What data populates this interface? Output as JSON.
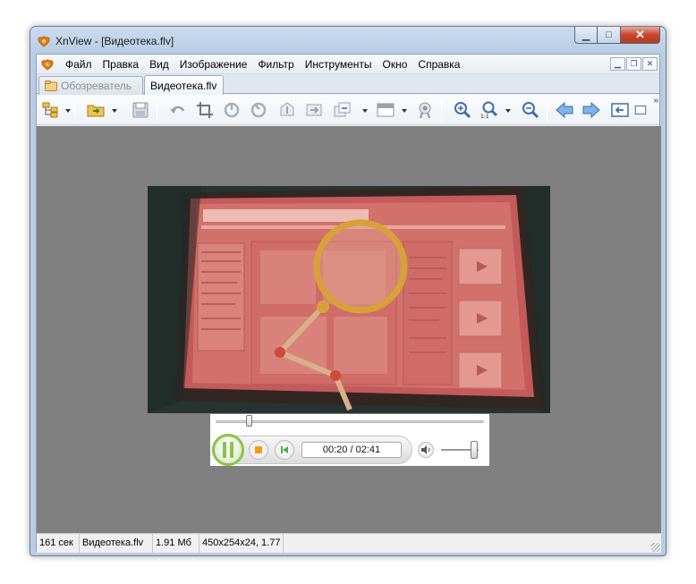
{
  "window": {
    "title": "XnView - [Видеотека.flv]"
  },
  "menubar": {
    "items": [
      "Файл",
      "Правка",
      "Вид",
      "Изображение",
      "Фильтр",
      "Инструменты",
      "Окно",
      "Справка"
    ]
  },
  "tabs": [
    {
      "label": "Обозреватель",
      "active": false
    },
    {
      "label": "Видеотека.flv",
      "active": true
    }
  ],
  "toolbar": {
    "buttons": [
      "browser-tree-icon",
      "open-folder-icon",
      "save-icon",
      "undo-icon",
      "crop-icon",
      "rotate-left-icon",
      "rotate-right-icon",
      "flip-icon",
      "convert-icon",
      "batch-icon",
      "view-mode-icon",
      "settings-icon",
      "zoom-in-icon",
      "zoom-actual-icon",
      "zoom-out-icon",
      "previous-icon",
      "next-icon",
      "fullscreen-icon",
      "exit-icon"
    ]
  },
  "player": {
    "time_display": "00:20 / 02:41",
    "progress": 0.124,
    "volume": 1.0,
    "state": "playing"
  },
  "statusbar": {
    "duration": "161 сек",
    "filename": "Видеотека.flv",
    "filesize": "1.91 Мб",
    "dimensions": "450x254x24, 1.77"
  },
  "colors": {
    "viewer_bg": "#808080",
    "play_accent": "#8bc34a",
    "stop_accent": "#f39a12"
  }
}
